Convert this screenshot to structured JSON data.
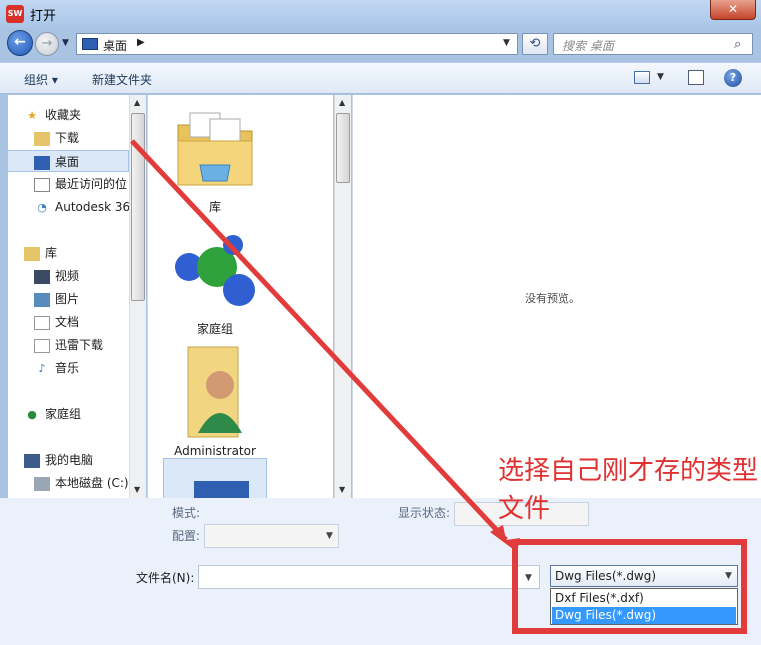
{
  "window": {
    "title": "打开",
    "app_icon": "SW"
  },
  "nav": {
    "address": "桌面",
    "search_placeholder": "搜索 桌面"
  },
  "toolbar": {
    "organize": "组织 ▾",
    "new_folder": "新建文件夹"
  },
  "sidebar": {
    "favorites": "收藏夹",
    "items": [
      {
        "label": "下载",
        "icon": "download-icon"
      },
      {
        "label": "桌面",
        "icon": "desktop-icon"
      },
      {
        "label": "最近访问的位",
        "icon": "recent-icon"
      },
      {
        "label": "Autodesk 36",
        "icon": "autodesk-icon"
      }
    ],
    "libraries": "库",
    "lib_items": [
      {
        "label": "视频",
        "icon": "video-icon"
      },
      {
        "label": "图片",
        "icon": "picture-icon"
      },
      {
        "label": "文档",
        "icon": "document-icon"
      },
      {
        "label": "迅雷下载",
        "icon": "download-icon"
      },
      {
        "label": "音乐",
        "icon": "music-icon"
      }
    ],
    "homegroup": "家庭组",
    "computer": "我的电脑",
    "disk": "本地磁盘 (C:)"
  },
  "files": [
    {
      "name": "库",
      "icon": "library-folder-icon"
    },
    {
      "name": "家庭组",
      "icon": "homegroup-icon"
    },
    {
      "name": "Administrator",
      "icon": "user-folder-icon"
    }
  ],
  "preview": {
    "text": "没有预览。"
  },
  "bottom": {
    "mode_label": "模式:",
    "config_label": "配置:",
    "display_state_label": "显示状态:",
    "filename_label": "文件名(N):",
    "filename_value": "",
    "filetype_selected": "Dwg Files(*.dwg)",
    "filetype_options": [
      "Dxf Files(*.dxf)",
      "Dwg Files(*.dwg)"
    ]
  },
  "annotation": {
    "text": "选择自己刚才存的类型文件",
    "color": "#e03030"
  }
}
